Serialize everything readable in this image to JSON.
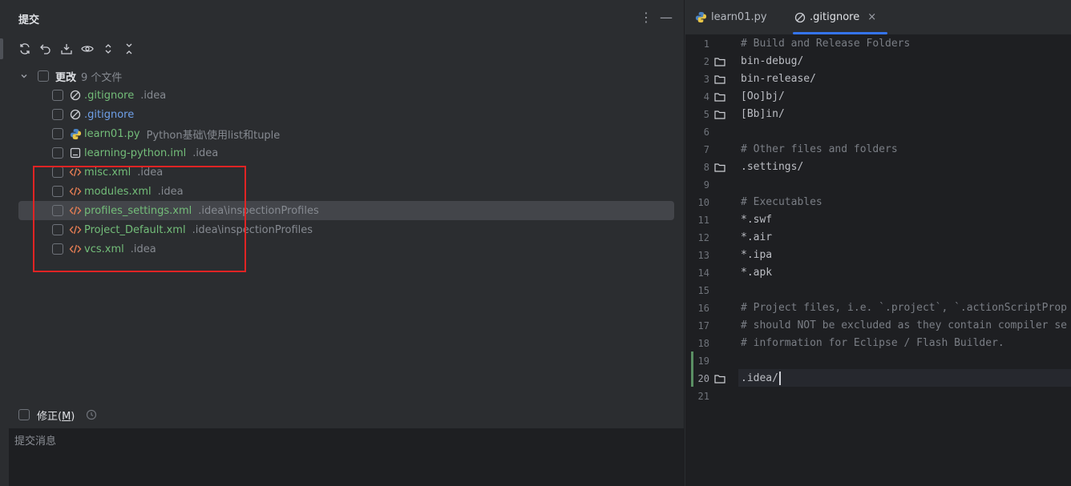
{
  "commit_panel": {
    "title": "提交",
    "menu_icon": "more-vertical-icon",
    "minimize_icon": "minimize-icon",
    "toolbar": [
      "refresh-icon",
      "rollback-icon",
      "shelve-icon",
      "preview-diff-icon",
      "expand-all-icon",
      "collapse-all-icon"
    ],
    "group": {
      "label": "更改",
      "count": "9 个文件"
    },
    "files": [
      {
        "name": ".gitignore",
        "path": ".idea",
        "icon": "ignore-file-icon",
        "color": "green"
      },
      {
        "name": ".gitignore",
        "path": "",
        "icon": "ignore-file-icon",
        "color": "blue"
      },
      {
        "name": "learn01.py",
        "path": "Python基础\\使用list和tuple",
        "icon": "python-icon",
        "color": "green"
      },
      {
        "name": "learning-python.iml",
        "path": ".idea",
        "icon": "iml-file-icon",
        "color": "green"
      },
      {
        "name": "misc.xml",
        "path": ".idea",
        "icon": "xml-file-icon",
        "color": "green"
      },
      {
        "name": "modules.xml",
        "path": ".idea",
        "icon": "xml-file-icon",
        "color": "green"
      },
      {
        "name": "profiles_settings.xml",
        "path": ".idea\\inspectionProfiles",
        "icon": "xml-file-icon",
        "color": "green"
      },
      {
        "name": "Project_Default.xml",
        "path": ".idea\\inspectionProfiles",
        "icon": "xml-file-icon",
        "color": "green"
      },
      {
        "name": "vcs.xml",
        "path": ".idea",
        "icon": "xml-file-icon",
        "color": "green"
      }
    ],
    "amend_label": "修正(",
    "amend_mnemonic": "M",
    "amend_suffix": ")",
    "commit_message_placeholder": "提交消息"
  },
  "editor": {
    "tabs": [
      {
        "label": "learn01.py",
        "icon": "python-icon",
        "active": false
      },
      {
        "label": ".gitignore",
        "icon": "ignore-file-icon",
        "active": true,
        "close": "×"
      }
    ],
    "lines": [
      {
        "n": "1",
        "text": "# Build and Release Folders",
        "comment": true
      },
      {
        "n": "2",
        "text": "bin-debug/",
        "comment": false,
        "folder": true
      },
      {
        "n": "3",
        "text": "bin-release/",
        "comment": false,
        "folder": true
      },
      {
        "n": "4",
        "text": "[Oo]bj/",
        "comment": false,
        "folder": true
      },
      {
        "n": "5",
        "text": "[Bb]in/",
        "comment": false,
        "folder": true
      },
      {
        "n": "6",
        "text": "",
        "comment": false
      },
      {
        "n": "7",
        "text": "# Other files and folders",
        "comment": true
      },
      {
        "n": "8",
        "text": ".settings/",
        "comment": false,
        "folder": true
      },
      {
        "n": "9",
        "text": "",
        "comment": false
      },
      {
        "n": "10",
        "text": "# Executables",
        "comment": true
      },
      {
        "n": "11",
        "text": "*.swf",
        "comment": false
      },
      {
        "n": "12",
        "text": "*.air",
        "comment": false
      },
      {
        "n": "13",
        "text": "*.ipa",
        "comment": false
      },
      {
        "n": "14",
        "text": "*.apk",
        "comment": false
      },
      {
        "n": "15",
        "text": "",
        "comment": false
      },
      {
        "n": "16",
        "text": "# Project files, i.e. `.project`, `.actionScriptProp",
        "comment": true
      },
      {
        "n": "17",
        "text": "# should NOT be excluded as they contain compiler se",
        "comment": true
      },
      {
        "n": "18",
        "text": "# information for Eclipse / Flash Builder.",
        "comment": true
      },
      {
        "n": "19",
        "text": "",
        "comment": false
      },
      {
        "n": "20",
        "text": ".idea/",
        "comment": false,
        "folder": true,
        "current": true
      },
      {
        "n": "21",
        "text": "",
        "comment": false
      }
    ]
  },
  "colors": {
    "accent": "#3574f0",
    "added": "#73bd79",
    "highlight": "#e02424"
  }
}
